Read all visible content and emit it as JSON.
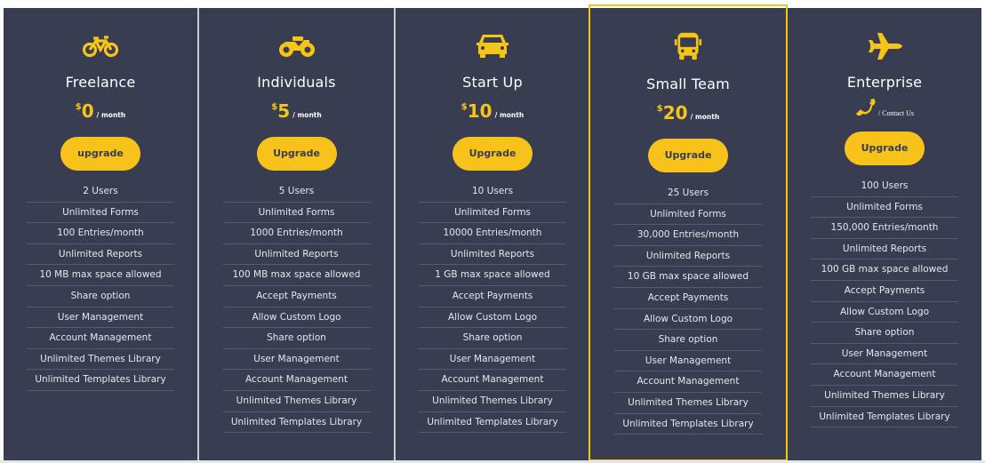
{
  "colors": {
    "accent": "#f5c518",
    "panel": "#393d51",
    "text": "#ffffff"
  },
  "plans": [
    {
      "name": "Freelance",
      "icon": "bicycle-icon",
      "currency": "$",
      "amount": "0",
      "period": "/ month",
      "button": "upgrade",
      "featured": false,
      "features": [
        "2 Users",
        "Unlimited Forms",
        "100 Entries/month",
        "Unlimited Reports",
        "10 MB max space allowed",
        "Share option",
        "User Management",
        "Account Management",
        "Unlimited Themes Library",
        "Unlimited Templates Library"
      ]
    },
    {
      "name": "Individuals",
      "icon": "motorcycle-icon",
      "currency": "$",
      "amount": "5",
      "period": "/ month",
      "button": "Upgrade",
      "featured": false,
      "features": [
        "5 Users",
        "Unlimited Forms",
        "1000 Entries/month",
        "Unlimited Reports",
        "100 MB max space allowed",
        "Accept Payments",
        "Allow Custom Logo",
        "Share option",
        "User Management",
        "Account Management",
        "Unlimited Themes Library",
        "Unlimited Templates Library"
      ]
    },
    {
      "name": "Start Up",
      "icon": "car-icon",
      "currency": "$",
      "amount": "10",
      "period": "/ month",
      "button": "Upgrade",
      "featured": false,
      "features": [
        "10 Users",
        "Unlimited Forms",
        "10000 Entries/month",
        "Unlimited Reports",
        "1 GB max space allowed",
        "Accept Payments",
        "Allow Custom Logo",
        "Share option",
        "User Management",
        "Account Management",
        "Unlimited Themes Library",
        "Unlimited Templates Library"
      ]
    },
    {
      "name": "Small Team",
      "icon": "bus-icon",
      "currency": "$",
      "amount": "20",
      "period": "/ month",
      "button": "Upgrade",
      "featured": true,
      "features": [
        "25 Users",
        "Unlimited Forms",
        "30,000 Entries/month",
        "Unlimited Reports",
        "10 GB max space allowed",
        "Accept Payments",
        "Allow Custom Logo",
        "Share option",
        "User Management",
        "Account Management",
        "Unlimited Themes Library",
        "Unlimited Templates Library"
      ]
    },
    {
      "name": "Enterprise",
      "icon": "plane-icon",
      "contact_icon": "phone-icon",
      "period": "/ Contact Us",
      "button": "Upgrade",
      "featured": false,
      "features": [
        "100 Users",
        "Unlimited Forms",
        "150,000 Entries/month",
        "Unlimited Reports",
        "100 GB max space allowed",
        "Accept Payments",
        "Allow Custom Logo",
        "Share option",
        "User Management",
        "Account Management",
        "Unlimited Themes Library",
        "Unlimited Templates Library"
      ]
    }
  ]
}
